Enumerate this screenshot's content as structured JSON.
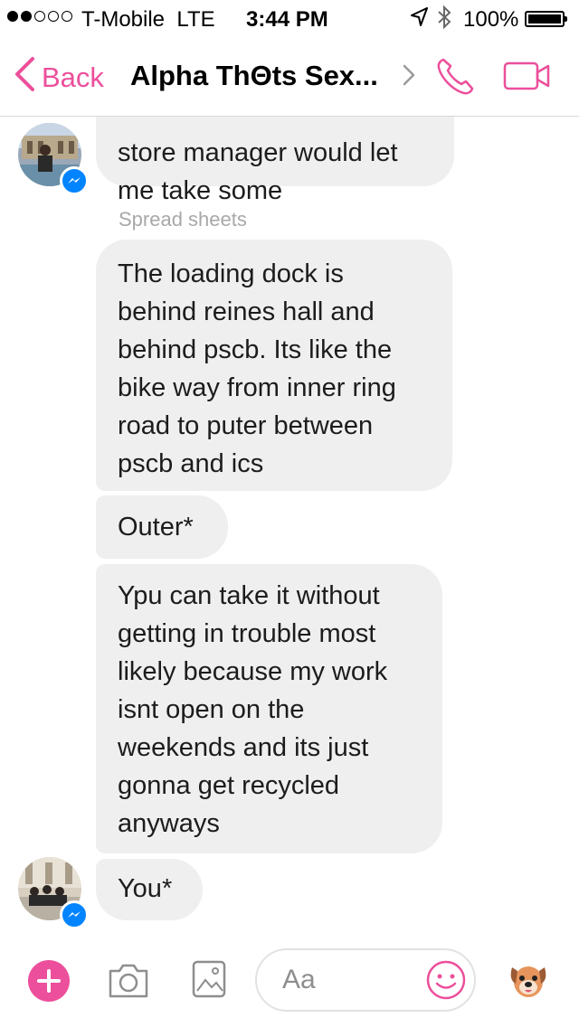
{
  "status_bar": {
    "carrier": "T-Mobile",
    "network": "LTE",
    "time": "3:44 PM",
    "battery": "100%",
    "signal_bars": 2,
    "signal_total": 5
  },
  "nav": {
    "back_label": "Back",
    "title": "Alpha ThΘts Sex...",
    "accent_color": "#ec4f9b"
  },
  "messages": [
    {
      "text": "store manager would let\nme take some"
    },
    {
      "text": "The loading dock is\nbehind reines hall and\nbehind pscb. Its like the\nbike way from inner ring\nroad to puter between\npscb and ics"
    },
    {
      "text": "Outer*"
    },
    {
      "text": "Ypu can take it without\ngetting in trouble most\nlikely because my work\nisnt open on the\nweekends and its just\ngonna get recycled\nanyways"
    },
    {
      "text": "You*"
    }
  ],
  "sender_label": "Spread sheets",
  "composer": {
    "placeholder": "Aa"
  },
  "icons": [
    "back-chevron-icon",
    "chevron-right-icon",
    "phone-icon",
    "video-camera-icon",
    "messenger-badge-icon",
    "plus-icon",
    "camera-icon",
    "gallery-icon",
    "smiley-icon",
    "dog-sticker-icon",
    "location-arrow-icon",
    "bluetooth-icon",
    "battery-icon"
  ],
  "colors": {
    "accent": "#ec4f9b",
    "bubble": "#efefef",
    "messenger_blue": "#0084ff"
  }
}
